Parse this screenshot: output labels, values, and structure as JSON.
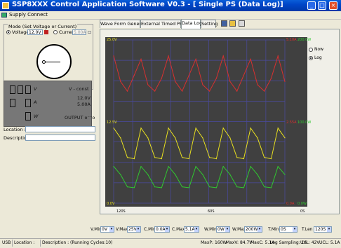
{
  "window": {
    "title": "SSP8XXX Control Application Software V0.3 - [ Single PS (Data Log)]",
    "minimize": "_",
    "maximize": "□",
    "close": "×"
  },
  "menu": {
    "supply_connect": "Supply Connect"
  },
  "mode": {
    "group_title": "Mode (Set Voltage or Current)",
    "voltage_label": "Voltage",
    "voltage_value": "12.0V",
    "current_label": "Current",
    "current_value": "5.00A",
    "selected": "voltage"
  },
  "display": {
    "v_unit": "V",
    "a_unit": "A",
    "w_unit": "W",
    "mode_text": "V - const",
    "voltage": "12.0V",
    "current": "5.00A",
    "output": "OUTPUT o⁻⁻o"
  },
  "fields": {
    "location_label": "Location :",
    "description_label": "Description :"
  },
  "tabs": [
    "Wave Form Generator",
    "External Timed Program",
    "Data Log",
    "Setting"
  ],
  "active_tab": "Data Log",
  "chart_data": {
    "type": "line",
    "axes": {
      "left": {
        "top": "25.0V",
        "mid": "12.5V",
        "bottom": "0.0V"
      },
      "right_current": {
        "top": "5.10A",
        "mid": "2.55A",
        "bottom": "0.0A"
      },
      "right_power": {
        "top": "200.0W",
        "mid": "100.0W",
        "bottom": "0.0W"
      },
      "x": {
        "left": "120S",
        "mid": "60S",
        "right": "0S"
      }
    },
    "legend": {
      "now": "Now",
      "log": "Log",
      "selected": "log"
    },
    "series": [
      {
        "name": "Current",
        "color": "#d83030",
        "values": [
          4.6,
          3.8,
          3.5,
          4.0,
          4.5,
          3.7,
          3.5,
          3.9,
          4.6,
          3.8,
          3.5,
          4.0,
          4.5,
          3.7,
          3.5,
          3.9,
          4.6,
          3.8,
          3.5,
          4.0,
          4.5,
          3.7,
          3.5,
          3.9,
          4.6,
          3.8
        ]
      },
      {
        "name": "Voltage",
        "color": "#e8e020",
        "values": [
          11.5,
          10.0,
          7.0,
          6.8,
          11.5,
          10.0,
          7.0,
          6.8,
          11.5,
          10.0,
          7.0,
          6.8,
          11.5,
          10.0,
          7.0,
          6.8,
          11.5,
          10.0,
          7.0,
          6.8,
          11.5,
          10.0,
          7.0,
          6.8,
          11.5,
          10.0
        ]
      },
      {
        "name": "Power",
        "color": "#30c830",
        "values": [
          45,
          35,
          20,
          19,
          45,
          35,
          20,
          19,
          45,
          35,
          20,
          19,
          45,
          35,
          20,
          19,
          45,
          35,
          20,
          19,
          45,
          35,
          20,
          19,
          45,
          35
        ]
      }
    ]
  },
  "controls": {
    "v_min_label": "V.Min",
    "v_min": "0V",
    "v_max_label": "V.Max",
    "v_max": "25V",
    "c_min_label": "C.Min",
    "c_min": "0.0A",
    "c_max_label": "C.Max",
    "c_max": "5.1A",
    "w_min_label": "W.Min",
    "w_min": "0W",
    "w_max_label": "W.Max",
    "w_max": "200W",
    "t_min_label": "T.Min",
    "t_min": "0S",
    "t_len_label": "T.Len",
    "t_len": "120S"
  },
  "status": {
    "usb": "USB",
    "location": "Location :",
    "description": "Description : (Running Cycles:10)",
    "maxp": "MaxP: 160W",
    "maxv": "MaxV: 84.7V",
    "maxc": "MaxC: 5.1A",
    "log_sampling": "Log Sampling: 1S",
    "uvl": "UVL: 42V",
    "ucl": "UCL: 5.1A"
  },
  "colors": {
    "titlebar": "#0046c8",
    "plot_bg": "#404040",
    "grid": "#4a4aa0",
    "current": "#d83030",
    "voltage": "#e8e020",
    "power": "#30c830"
  }
}
